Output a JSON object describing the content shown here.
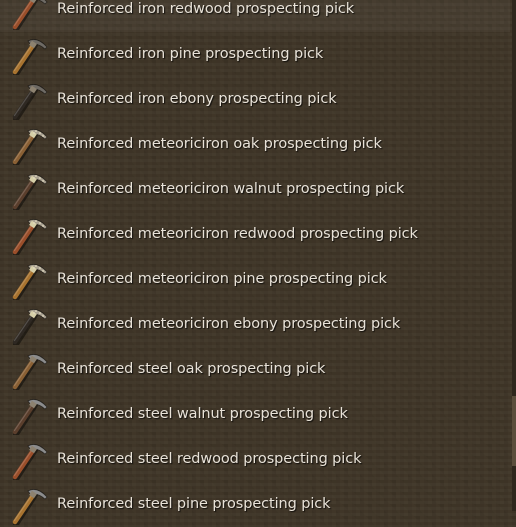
{
  "items": [
    {
      "label": "Reinforced iron redwood prospecting pick",
      "head": "iron",
      "handle": "#9a4e2a",
      "icon": "pickaxe-icon"
    },
    {
      "label": "Reinforced iron pine prospecting pick",
      "head": "iron",
      "handle": "#a8732f",
      "icon": "pickaxe-icon"
    },
    {
      "label": "Reinforced iron ebony prospecting pick",
      "head": "iron",
      "handle": "#2e2822",
      "icon": "pickaxe-icon"
    },
    {
      "label": "Reinforced meteoriciron oak prospecting pick",
      "head": "meteoriciron",
      "handle": "#8a6034",
      "icon": "pickaxe-icon"
    },
    {
      "label": "Reinforced meteoriciron walnut prospecting pick",
      "head": "meteoriciron",
      "handle": "#5a3e2c",
      "icon": "pickaxe-icon"
    },
    {
      "label": "Reinforced meteoriciron redwood prospecting pick",
      "head": "meteoriciron",
      "handle": "#9a4e2a",
      "icon": "pickaxe-icon"
    },
    {
      "label": "Reinforced meteoriciron pine prospecting pick",
      "head": "meteoriciron",
      "handle": "#a8732f",
      "icon": "pickaxe-icon"
    },
    {
      "label": "Reinforced meteoriciron ebony prospecting pick",
      "head": "meteoriciron",
      "handle": "#2e2822",
      "icon": "pickaxe-icon"
    },
    {
      "label": "Reinforced steel oak prospecting pick",
      "head": "steel",
      "handle": "#8a6034",
      "icon": "pickaxe-icon"
    },
    {
      "label": "Reinforced steel walnut prospecting pick",
      "head": "steel",
      "handle": "#5a3e2c",
      "icon": "pickaxe-icon"
    },
    {
      "label": "Reinforced steel redwood prospecting pick",
      "head": "steel",
      "handle": "#9a4e2a",
      "icon": "pickaxe-icon"
    },
    {
      "label": "Reinforced steel pine prospecting pick",
      "head": "steel",
      "handle": "#a8732f",
      "icon": "pickaxe-icon"
    }
  ],
  "colors": {
    "background": "#403628",
    "text": "#e8e2d8",
    "iron": "#6e6a64",
    "meteoriciron": "#a8a090",
    "steel": "#8c8c8c"
  }
}
